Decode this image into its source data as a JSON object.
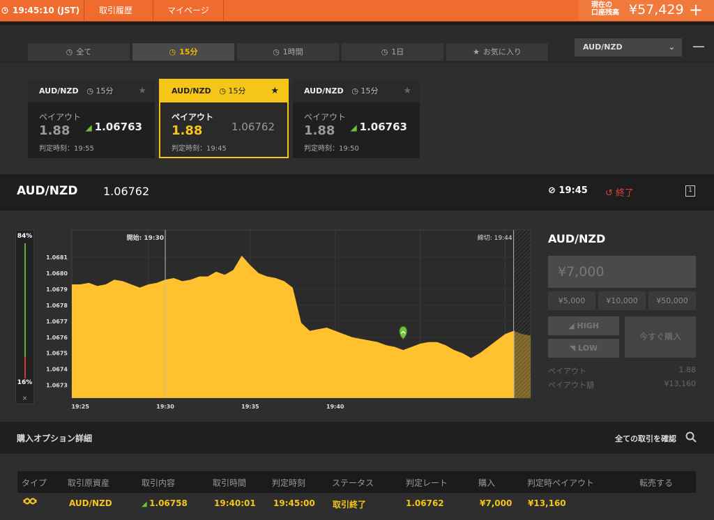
{
  "topbar": {
    "clock": "19:45:10 (JST)",
    "history": "取引履歴",
    "mypage": "マイページ",
    "balance_label_1": "現在の",
    "balance_label_2": "口座残高",
    "balance": "¥57,429",
    "add": "+"
  },
  "filters": {
    "tabs": [
      {
        "label": "全て"
      },
      {
        "label": "15分"
      },
      {
        "label": "1時間"
      },
      {
        "label": "1日"
      },
      {
        "label": "お気に入り"
      }
    ],
    "active_index": 1,
    "pair": "AUD/NZD",
    "chevron": "⌄"
  },
  "cards": [
    {
      "pair": "AUD/NZD",
      "period": "15分",
      "payout_label": "ペイアウト",
      "payout": "1.88",
      "rate": "1.06763",
      "judge": "判定時刻：19:55"
    },
    {
      "pair": "AUD/NZD",
      "period": "15分",
      "payout_label": "ペイアウト",
      "payout": "1.88",
      "rate": "1.06762",
      "judge": "判定時刻：19:45"
    },
    {
      "pair": "AUD/NZD",
      "period": "15分",
      "payout_label": "ペイアウト",
      "payout": "1.88",
      "rate": "1.06763",
      "judge": "判定時刻：19:50"
    }
  ],
  "asset": {
    "name": "AUD/NZD",
    "rate": "1.06762",
    "time": "19:45",
    "status": "終了",
    "icon_text": "1"
  },
  "gauge": {
    "high_pct": "84%",
    "low_pct": "16%",
    "high_fraction": 0.84,
    "close": "×"
  },
  "chart_data": {
    "type": "area",
    "start_marker": "開始: 19:30",
    "end_marker": "締切: 19:44",
    "y_ticks": [
      "1.0681",
      "1.0680",
      "1.0679",
      "1.0678",
      "1.0677",
      "1.0676",
      "1.0675",
      "1.0674",
      "1.0673"
    ],
    "x_ticks": [
      "19:25",
      "19:30",
      "19:35",
      "19:40"
    ],
    "ylim": [
      1.06722,
      1.06827
    ],
    "xlim": [
      1400,
      1670
    ],
    "entry_time_min": 1180.02,
    "entry_rate": 1.06758,
    "color": "#ffc12e",
    "points": [
      [
        1400,
        1.06793
      ],
      [
        1405,
        1.06793
      ],
      [
        1410,
        1.06794
      ],
      [
        1415,
        1.06792
      ],
      [
        1420,
        1.06793
      ],
      [
        1425,
        1.06796
      ],
      [
        1430,
        1.06795
      ],
      [
        1435,
        1.06793
      ],
      [
        1440,
        1.06791
      ],
      [
        1445,
        1.06793
      ],
      [
        1450,
        1.06794
      ],
      [
        1455,
        1.06796
      ],
      [
        1460,
        1.06797
      ],
      [
        1465,
        1.06795
      ],
      [
        1470,
        1.06796
      ],
      [
        1475,
        1.06798
      ],
      [
        1480,
        1.06798
      ],
      [
        1485,
        1.06801
      ],
      [
        1490,
        1.06799
      ],
      [
        1495,
        1.06802
      ],
      [
        1500,
        1.06811
      ],
      [
        1505,
        1.06805
      ],
      [
        1510,
        1.068
      ],
      [
        1515,
        1.06798
      ],
      [
        1520,
        1.06797
      ],
      [
        1525,
        1.06795
      ],
      [
        1530,
        1.06791
      ],
      [
        1535,
        1.06769
      ],
      [
        1540,
        1.06764
      ],
      [
        1545,
        1.06765
      ],
      [
        1550,
        1.06766
      ],
      [
        1555,
        1.06764
      ],
      [
        1560,
        1.06762
      ],
      [
        1565,
        1.0676
      ],
      [
        1570,
        1.06759
      ],
      [
        1575,
        1.06758
      ],
      [
        1580,
        1.06757
      ],
      [
        1585,
        1.06755
      ],
      [
        1590,
        1.06754
      ],
      [
        1595,
        1.06752
      ],
      [
        1600,
        1.06754
      ],
      [
        1605,
        1.06756
      ],
      [
        1610,
        1.06757
      ],
      [
        1615,
        1.06757
      ],
      [
        1620,
        1.06755
      ],
      [
        1625,
        1.06752
      ],
      [
        1630,
        1.0675
      ],
      [
        1635,
        1.06747
      ],
      [
        1640,
        1.0675
      ],
      [
        1645,
        1.06754
      ],
      [
        1650,
        1.06758
      ],
      [
        1655,
        1.06762
      ],
      [
        1660,
        1.06764
      ],
      [
        1665,
        1.06762
      ],
      [
        1670,
        1.06761
      ]
    ]
  },
  "panel": {
    "title": "AUD/NZD",
    "amount": "¥7,000",
    "amounts": [
      "¥5,000",
      "¥10,000",
      "¥50,000"
    ],
    "high": "HIGH",
    "low": "LOW",
    "buy_now": "今すぐ購入",
    "payout_label": "ペイアウト",
    "payout_value": "1.88",
    "payout_amount_label": "ペイアウト額",
    "payout_amount_value": "¥13,160"
  },
  "details": {
    "title": "購入オプション詳細",
    "all_trades": "全ての取引を確認",
    "headers": [
      "タイプ",
      "取引原資産",
      "取引内容",
      "取引時間",
      "判定時刻",
      "ステータス",
      "判定レート",
      "購入",
      "判定時ペイアウト",
      "転売する"
    ],
    "row": {
      "asset": "AUD/NZD",
      "content": "1.06758",
      "trade_time": "19:40:01",
      "judge_time": "19:45:00",
      "status": "取引終了",
      "judge_rate": "1.06762",
      "purchase": "¥7,000",
      "payout": "¥13,160"
    }
  }
}
